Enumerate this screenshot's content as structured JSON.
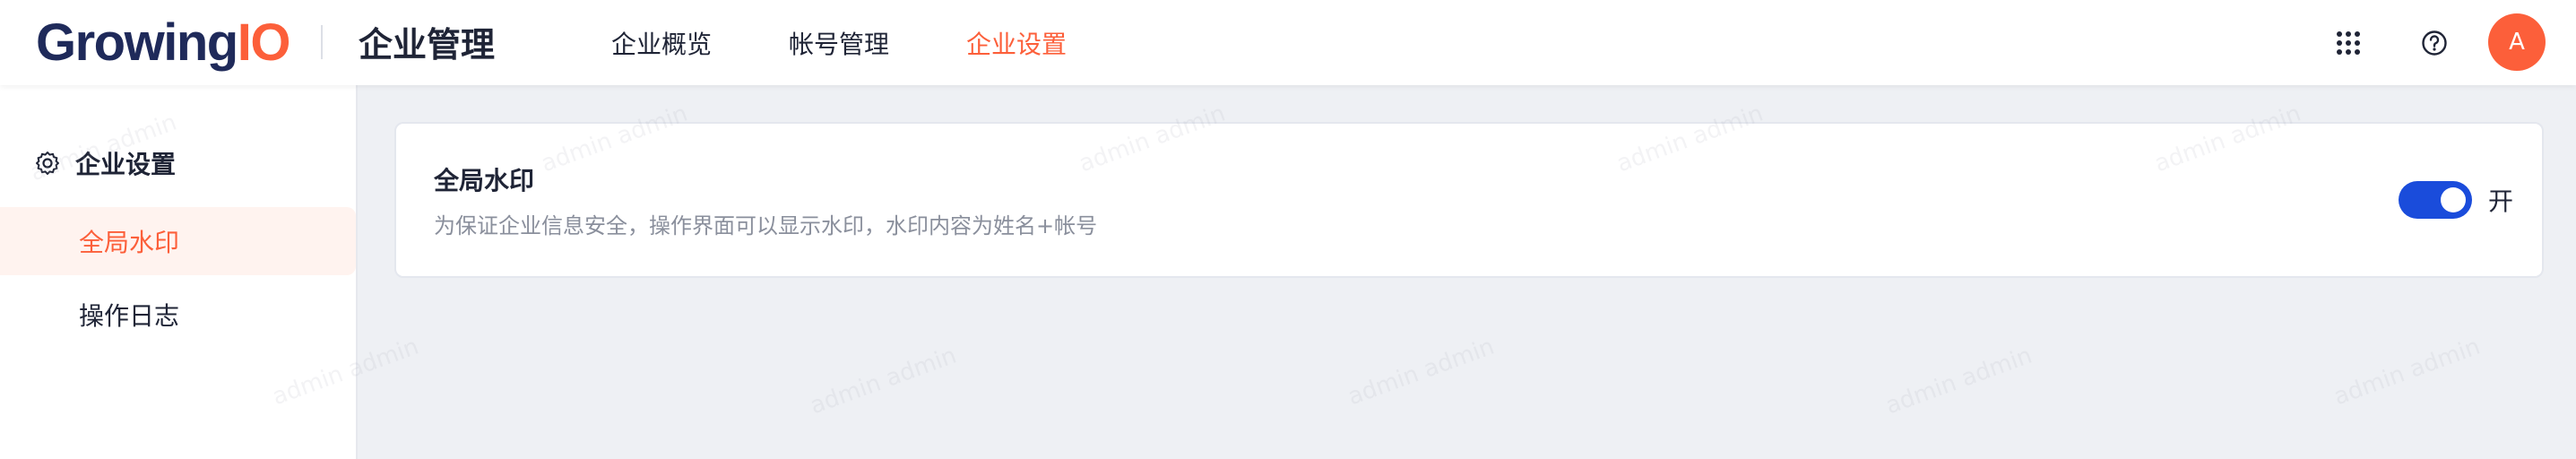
{
  "header": {
    "logo_prefix": "Growing",
    "logo_suffix": "IO",
    "product_title": "企业管理",
    "nav": [
      {
        "label": "企业概览",
        "active": false
      },
      {
        "label": "帐号管理",
        "active": false
      },
      {
        "label": "企业设置",
        "active": true
      }
    ],
    "icons": [
      "apps-grid-icon",
      "help-circle-icon"
    ],
    "avatar_initial": "A"
  },
  "sidebar": {
    "group_label": "企业设置",
    "group_icon": "gear-icon",
    "items": [
      {
        "label": "全局水印",
        "active": true
      },
      {
        "label": "操作日志",
        "active": false
      }
    ]
  },
  "main": {
    "card": {
      "title": "全局水印",
      "description": "为保证企业信息安全，操作界面可以显示水印，水印内容为姓名+帐号",
      "toggle_on": true,
      "toggle_label": "开"
    }
  },
  "watermark": {
    "text": "admin admin"
  },
  "colors": {
    "accent": "#fc5f3a",
    "brand_navy": "#1f2a5a",
    "toggle_on": "#1a4cdb",
    "background": "#eef0f4",
    "text_primary": "#1f2436",
    "text_secondary": "#8a8f9c"
  }
}
